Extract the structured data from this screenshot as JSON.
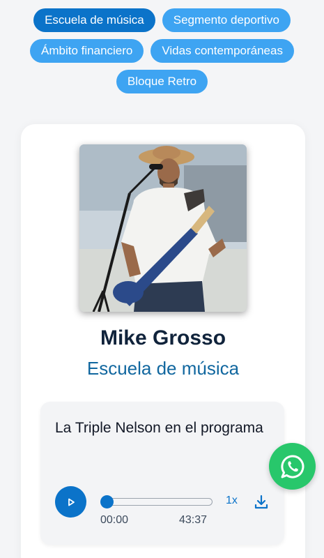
{
  "categories": [
    {
      "label": "Escuela de música",
      "active": true
    },
    {
      "label": "Segmento deportivo",
      "active": false
    },
    {
      "label": "Ámbito financiero",
      "active": false
    },
    {
      "label": "Vidas contemporáneas",
      "active": false
    },
    {
      "label": "Bloque Retro",
      "active": false
    }
  ],
  "profile": {
    "name": "Mike Grosso",
    "program": "Escuela de música"
  },
  "episode": {
    "title": "La Triple Nelson en el programa",
    "current_time": "00:00",
    "duration": "43:37",
    "speed": "1x",
    "progress": 0
  },
  "icons": {
    "play": "play-icon",
    "download": "download-icon",
    "whatsapp": "whatsapp-icon"
  },
  "colors": {
    "chip": "#3ea4f2",
    "chip_active": "#0b73c9",
    "accent": "#0b73c9",
    "program_text": "#11679f",
    "whatsapp": "#28c76b"
  }
}
